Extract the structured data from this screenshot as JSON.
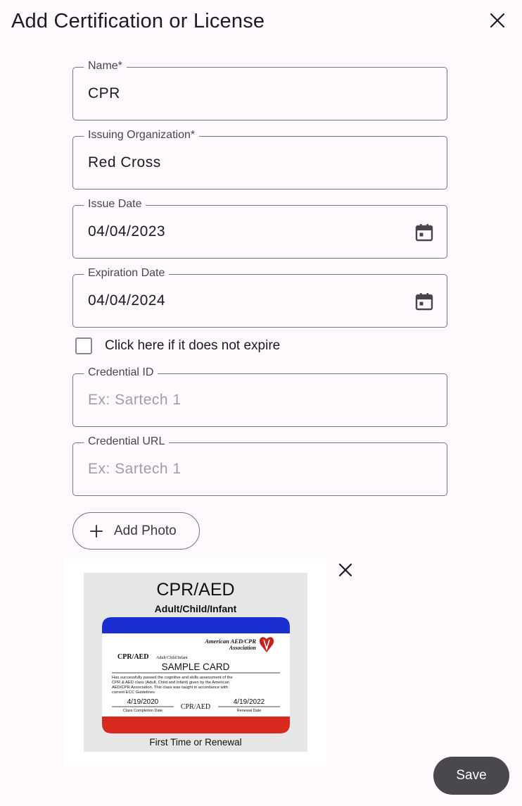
{
  "dialog": {
    "title": "Add Certification or License"
  },
  "fields": {
    "name": {
      "label": "Name*",
      "value": "CPR"
    },
    "issuing_org": {
      "label": "Issuing Organization*",
      "value": "Red Cross"
    },
    "issue_date": {
      "label": "Issue Date",
      "value": "04/04/2023"
    },
    "expiration_date": {
      "label": "Expiration Date",
      "value": "04/04/2024"
    },
    "credential_id": {
      "label": "Credential ID",
      "placeholder": "Ex: Sartech 1"
    },
    "credential_url": {
      "label": "Credential URL",
      "placeholder": "Ex: Sartech 1"
    }
  },
  "no_expire": {
    "label": "Click here if it does not expire",
    "checked": false
  },
  "add_photo": {
    "label": "Add Photo"
  },
  "photo": {
    "heading": "CPR/AED",
    "subheading": "Adult/Child/Infant",
    "org_line1": "American AED/CPR",
    "org_line2": "Association",
    "card_title_main": "CPR/AED",
    "card_title_sub": "Adult/Child/Infant",
    "card_name": "SAMPLE CARD",
    "card_text_1": "Has successfully passed the cognitive and skills assessment of the",
    "card_text_2": "CPR & AED class (Adult, Child and Infant) given by the American",
    "card_text_3": "AED/CPR Association. This class was taught in accordance with",
    "card_text_4": "current ECC Guidelines",
    "completion_date": "4/19/2020",
    "completion_label": "Class Completion Date",
    "center_label": "CPR/AED",
    "renewal_date": "4/19/2022",
    "renewal_label": "Renewal Date",
    "footer": "First Time or Renewal"
  },
  "actions": {
    "save_label": "Save"
  },
  "colors": {
    "card_blue": "#1a2fd0",
    "card_red": "#d9281e",
    "save_bg": "#4a474d"
  }
}
